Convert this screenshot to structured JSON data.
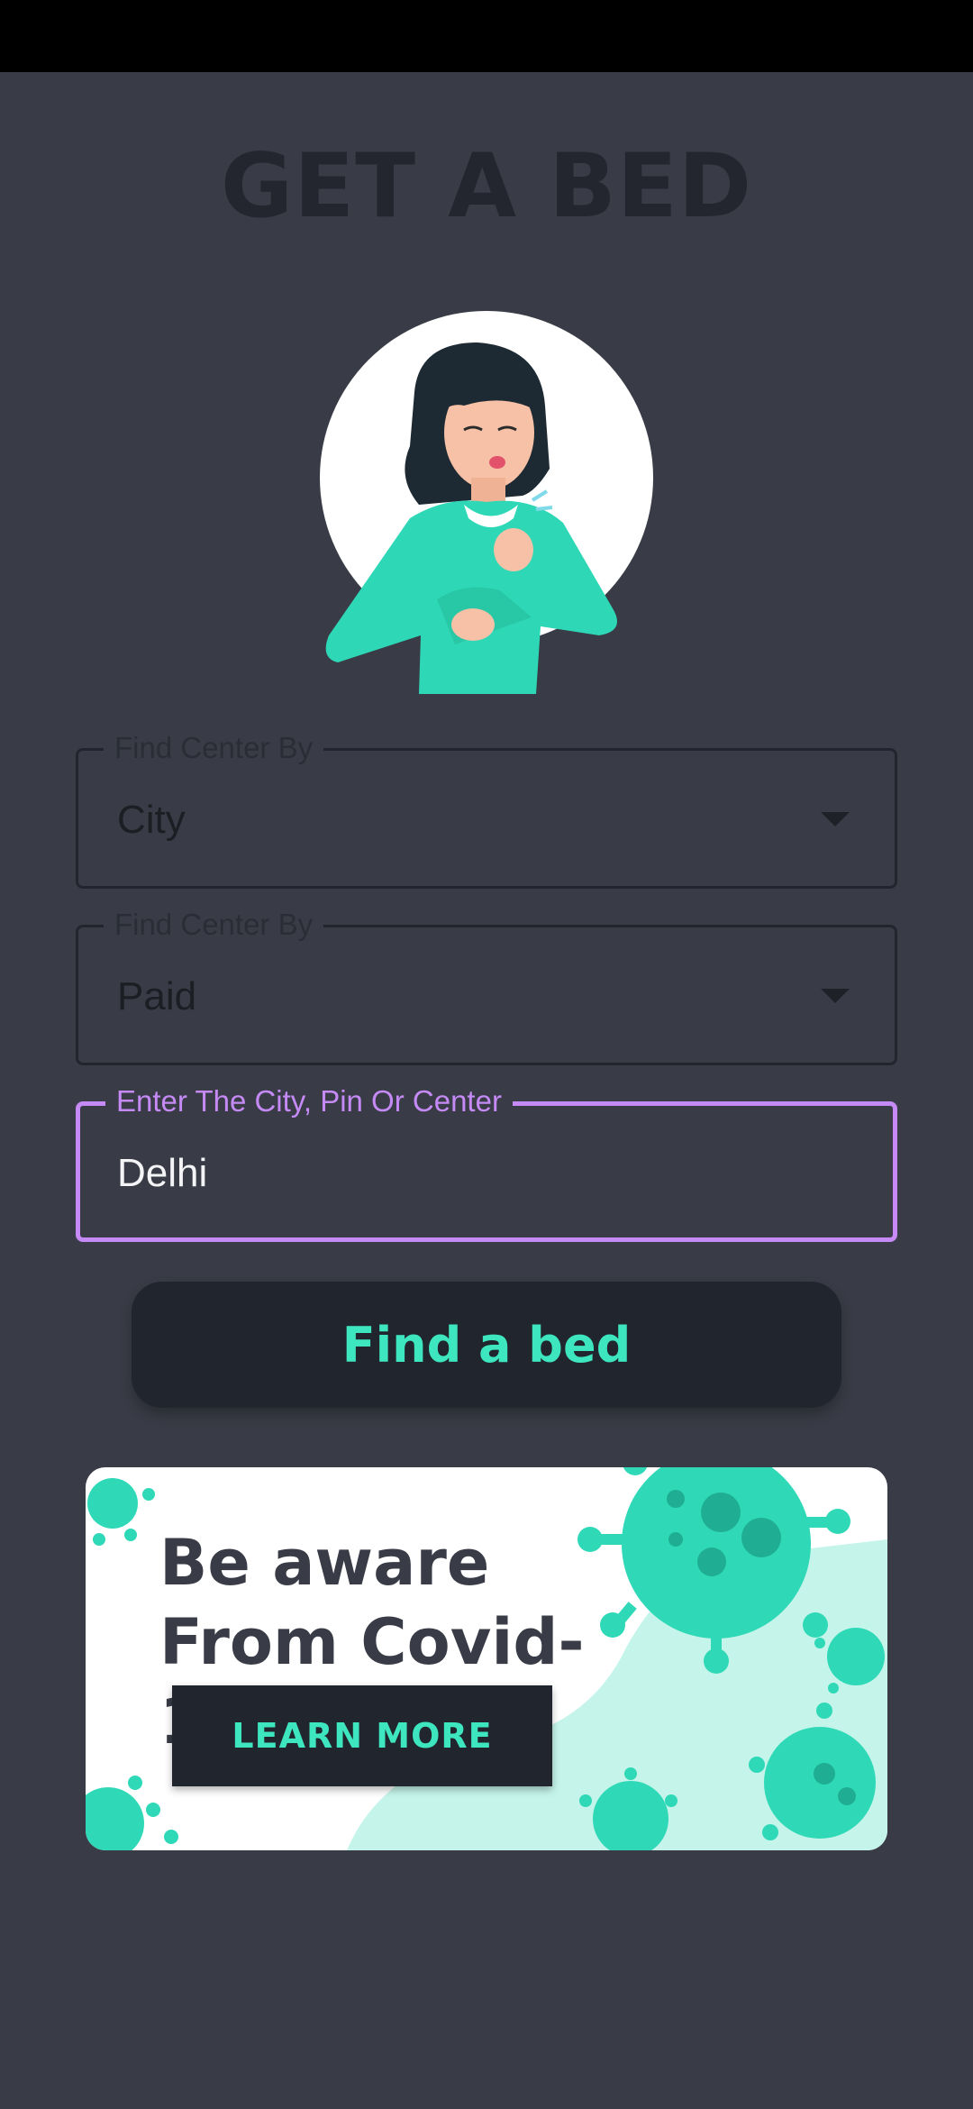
{
  "header": {
    "title": "GET A BED"
  },
  "illustration": {
    "icon": "coughing-woman-illustration"
  },
  "form": {
    "center_type": {
      "label": "Find Center By",
      "value": "City"
    },
    "payment_type": {
      "label": "Find Center By",
      "value": "Paid"
    },
    "search": {
      "label": "Enter The City, Pin Or Center",
      "value": "Delhi"
    },
    "submit_label": "Find a bed"
  },
  "banner": {
    "heading": "Be aware From Covid-19",
    "button_label": "LEARN MORE",
    "icon": "virus-icon"
  },
  "colors": {
    "background": "#393c46",
    "accent": "#3ee6bf",
    "focus": "#c58af5",
    "dark": "#21252e"
  }
}
